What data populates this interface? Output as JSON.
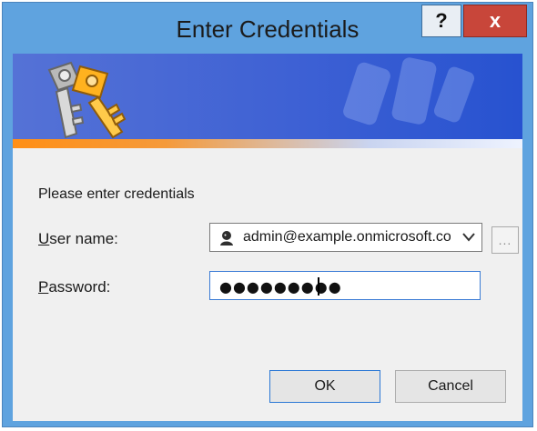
{
  "window": {
    "title": "Enter Credentials",
    "controls": {
      "help": "?",
      "close": "x"
    }
  },
  "prompt": "Please enter credentials",
  "fields": {
    "username": {
      "label_before": "",
      "label_mnemonic": "U",
      "label_after": "ser name:",
      "value": "admin@example.onmicrosoft.com",
      "dropdown_icon": "chevron-down-icon",
      "browse_label": "..."
    },
    "password": {
      "label_mnemonic": "P",
      "label_after": "assword:",
      "value_mask": "●●●●●●●●●"
    }
  },
  "buttons": {
    "ok": "OK",
    "cancel": "Cancel"
  },
  "colors": {
    "titlebar": "#5fa3df",
    "close_button": "#c8463a",
    "banner_start": "#5572d6",
    "banner_end": "#2752d0",
    "accent_stripe": "#ff8f16",
    "dialog_bg": "#f0f0f0"
  },
  "icons": {
    "banner": "keys-icon",
    "user": "user-avatar-icon",
    "watermark": "keys-watermark-icon"
  }
}
